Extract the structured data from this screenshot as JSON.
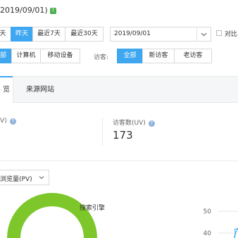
{
  "header": {
    "date_title": "2019/09/01)",
    "help_badge": "?"
  },
  "range_buttons": [
    {
      "label": "天",
      "active": false
    },
    {
      "label": "昨天",
      "active": true
    },
    {
      "label": "最近7天",
      "active": false
    },
    {
      "label": "最近30天",
      "active": false
    }
  ],
  "date_picker": {
    "value": "2019/09/01"
  },
  "compare": {
    "label": "对比"
  },
  "device": {
    "options": [
      "部",
      "计算机",
      "移动设备"
    ],
    "active_index": 0
  },
  "visitor": {
    "label": "访客:",
    "options": [
      "全部",
      "新访客",
      "老访客"
    ],
    "active_index": 0
  },
  "tabs": [
    {
      "label": "览",
      "active": true
    },
    {
      "label": "来源网站",
      "active": false
    }
  ],
  "metrics": {
    "pv": {
      "label": "V)",
      "help": "?"
    },
    "uv": {
      "label": "访客数(UV)",
      "help": "?",
      "value": "173"
    }
  },
  "metric_select": {
    "value": "浏览量(PV)"
  },
  "chart": {
    "donut_label": "搜索引擎",
    "y_ticks": [
      "50",
      "40"
    ],
    "colors": {
      "donut": "#7ec72b",
      "line": "#3fa7f0",
      "grid": "#e5e5e5"
    }
  },
  "colors": {
    "accent": "#3fa7f0",
    "green_badge": "#4caf50"
  }
}
